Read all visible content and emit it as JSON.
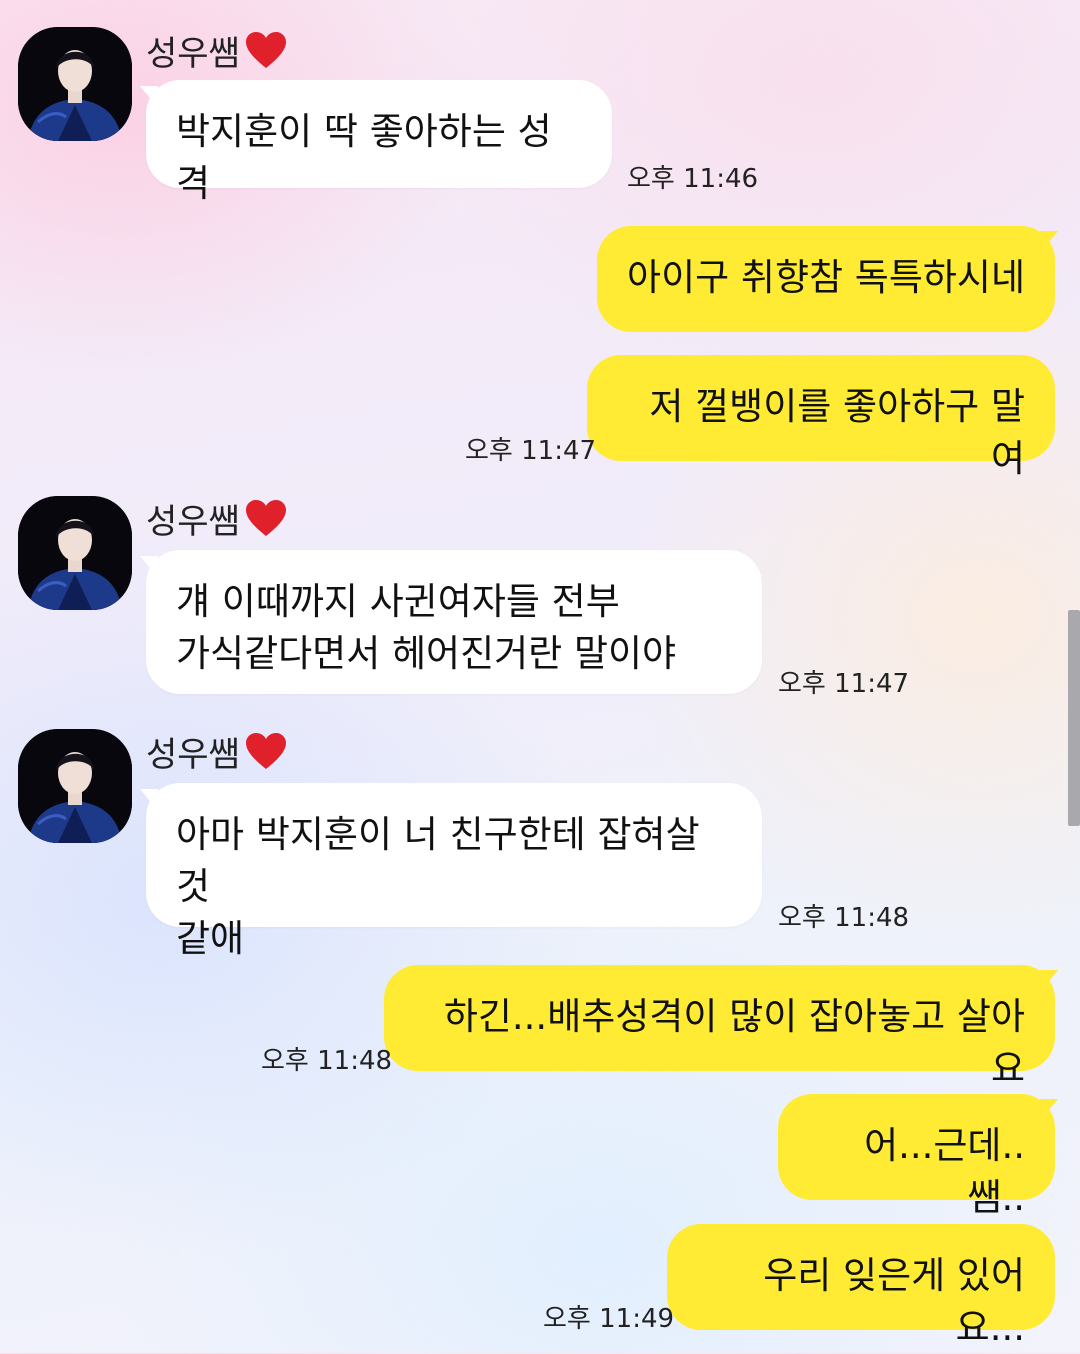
{
  "conversation": {
    "sender_name": "성우쌤",
    "messages": [
      {
        "text": "박지훈이 딱 좋아하는 성격",
        "time": "오후 11:46"
      },
      {
        "text": "아이구 취향참 독특하시네"
      },
      {
        "text": "저 껄뱅이를 좋아하구 말여",
        "time": "오후 11:47"
      },
      {
        "text": "걔 이때까지 사귄여자들 전부\n가식같다면서 헤어진거란 말이야",
        "time": "오후 11:47"
      },
      {
        "text": "아마 박지훈이 너 친구한테 잡혀살것\n같애",
        "time": "오후 11:48"
      },
      {
        "text": "하긴...배추성격이 많이 잡아놓고 살아요",
        "time": "오후 11:48"
      },
      {
        "text": "어...근데..쌤.."
      },
      {
        "text": "우리 잊은게 있어요...",
        "time": "오후 11:49"
      }
    ]
  },
  "colors": {
    "outgoing_bubble": "#ffeb33",
    "incoming_bubble": "#ffffff",
    "heart": "#e0202a"
  },
  "icons": {
    "sender_badge": "heart-icon"
  }
}
